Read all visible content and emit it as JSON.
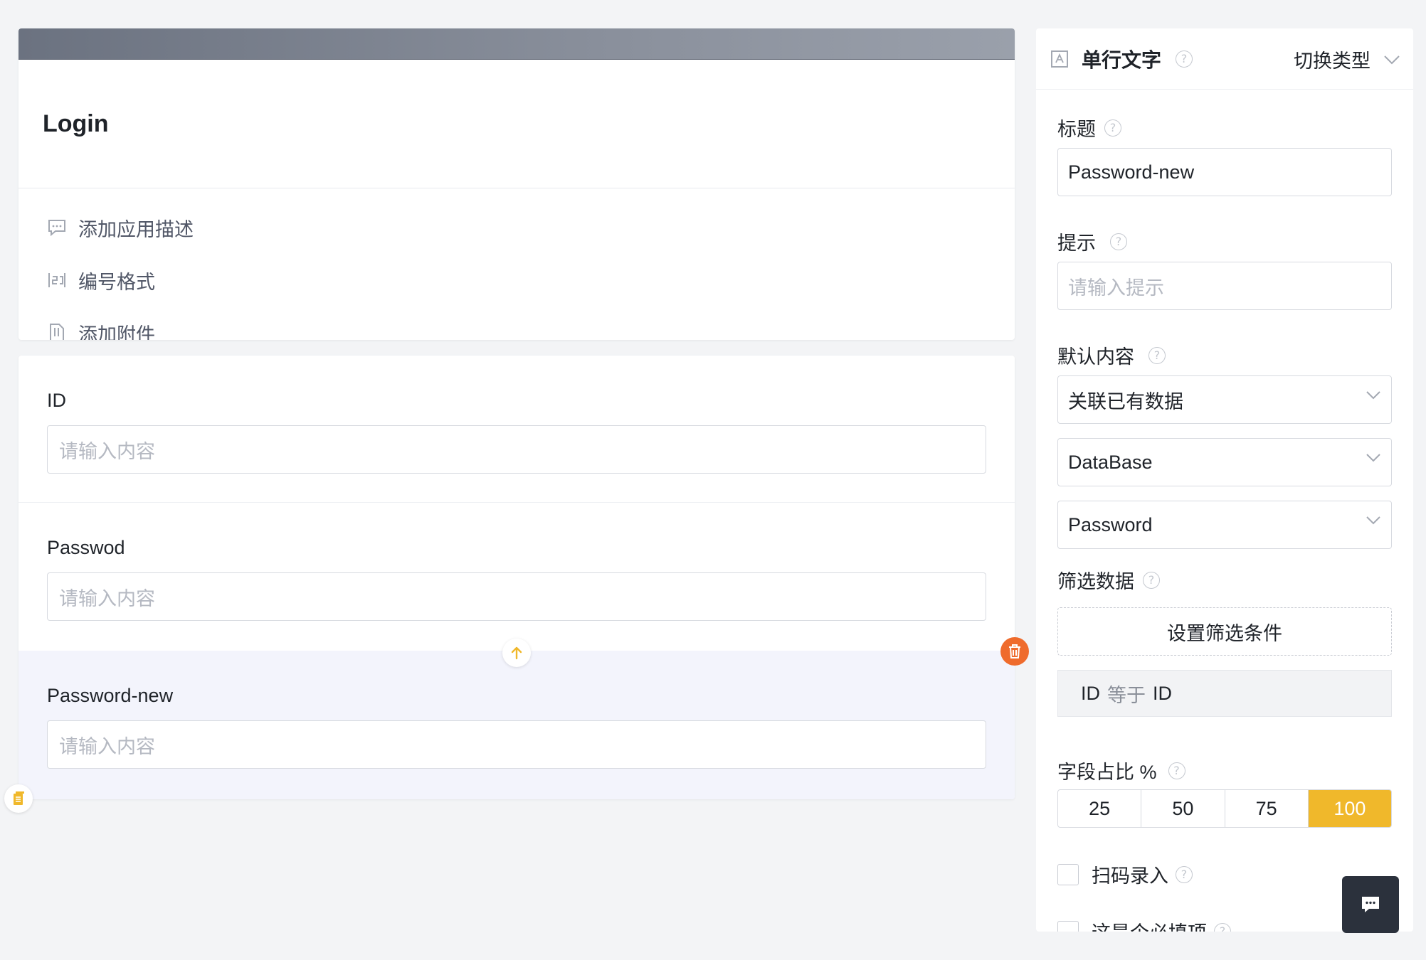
{
  "form": {
    "title": "Login",
    "meta": [
      {
        "icon": "comment-icon",
        "label": "添加应用描述"
      },
      {
        "icon": "serial-number-icon",
        "label": "编号格式"
      },
      {
        "icon": "attachment-icon",
        "label": "添加附件"
      }
    ],
    "fields": [
      {
        "label": "ID",
        "placeholder": "请输入内容"
      },
      {
        "label": "Passwod",
        "placeholder": "请输入内容"
      },
      {
        "label": "Password-new",
        "placeholder": "请输入内容",
        "selected": true
      }
    ]
  },
  "panel": {
    "type_label": "单行文字",
    "switch_label": "切换类型",
    "title_label": "标题",
    "title_value": "Password-new",
    "hint_label": "提示",
    "hint_placeholder": "请输入提示",
    "default_label": "默认内容",
    "default_mode": "关联已有数据",
    "source": "DataBase",
    "source_field": "Password",
    "filter_label": "筛选数据",
    "filter_button": "设置筛选条件",
    "condition": {
      "left": "ID",
      "op": "等于",
      "right": "ID"
    },
    "ratio_label": "字段占比 %",
    "ratio_options": [
      "25",
      "50",
      "75",
      "100"
    ],
    "ratio_selected": "100",
    "scan_label": "扫码录入",
    "required_label": "这是个必填项"
  },
  "colors": {
    "accent": "#f0b82b",
    "delete": "#ef6b2c",
    "selected_bg": "#f3f4fc"
  }
}
